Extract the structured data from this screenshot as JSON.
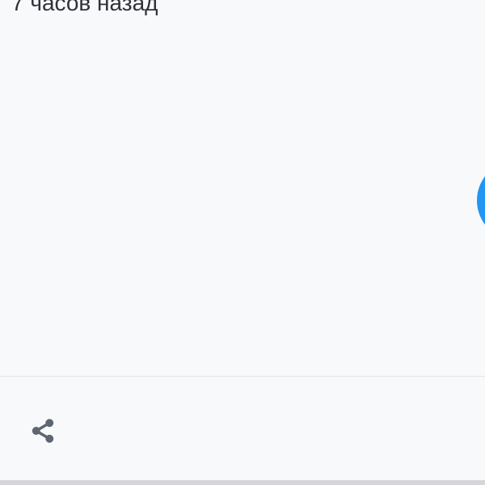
{
  "post": {
    "timestamp": "7 часов назад"
  },
  "actions": {
    "share_icon": "share-icon"
  },
  "colors": {
    "background": "#f8f9fb",
    "accent": "#2196f3",
    "icon": "#5f6673",
    "text": "#2f3338",
    "divider": "#e1e4e8"
  }
}
